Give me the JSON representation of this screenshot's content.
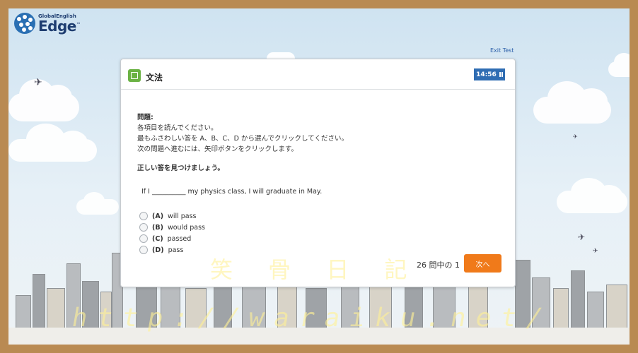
{
  "logo": {
    "small": "GlobalEnglish",
    "big": "Edge",
    "tm": "™"
  },
  "header": {
    "exit_label": "Exit Test"
  },
  "section": {
    "title": "文法",
    "timer": "14:56"
  },
  "instructions": {
    "heading": "問題:",
    "lines": [
      "各項目を読んでください。",
      "最もふさわしい答を A、B、C、D から選んでクリックしてください。",
      "次の問題へ進むには、矢印ボタンをクリックします。"
    ],
    "task": "正しい答を見つけましょう。"
  },
  "question": {
    "text": "If I __________ my physics class, I will graduate in May."
  },
  "options": [
    {
      "letter": "(A)",
      "text": "will pass"
    },
    {
      "letter": "(B)",
      "text": "would pass"
    },
    {
      "letter": "(C)",
      "text": "passed"
    },
    {
      "letter": "(D)",
      "text": "pass"
    }
  ],
  "footer": {
    "progress": "26 問中の 1",
    "next_label": "次へ"
  },
  "watermark": {
    "title": "笑 骨 日 記",
    "url": "http://waraiku.net/"
  }
}
